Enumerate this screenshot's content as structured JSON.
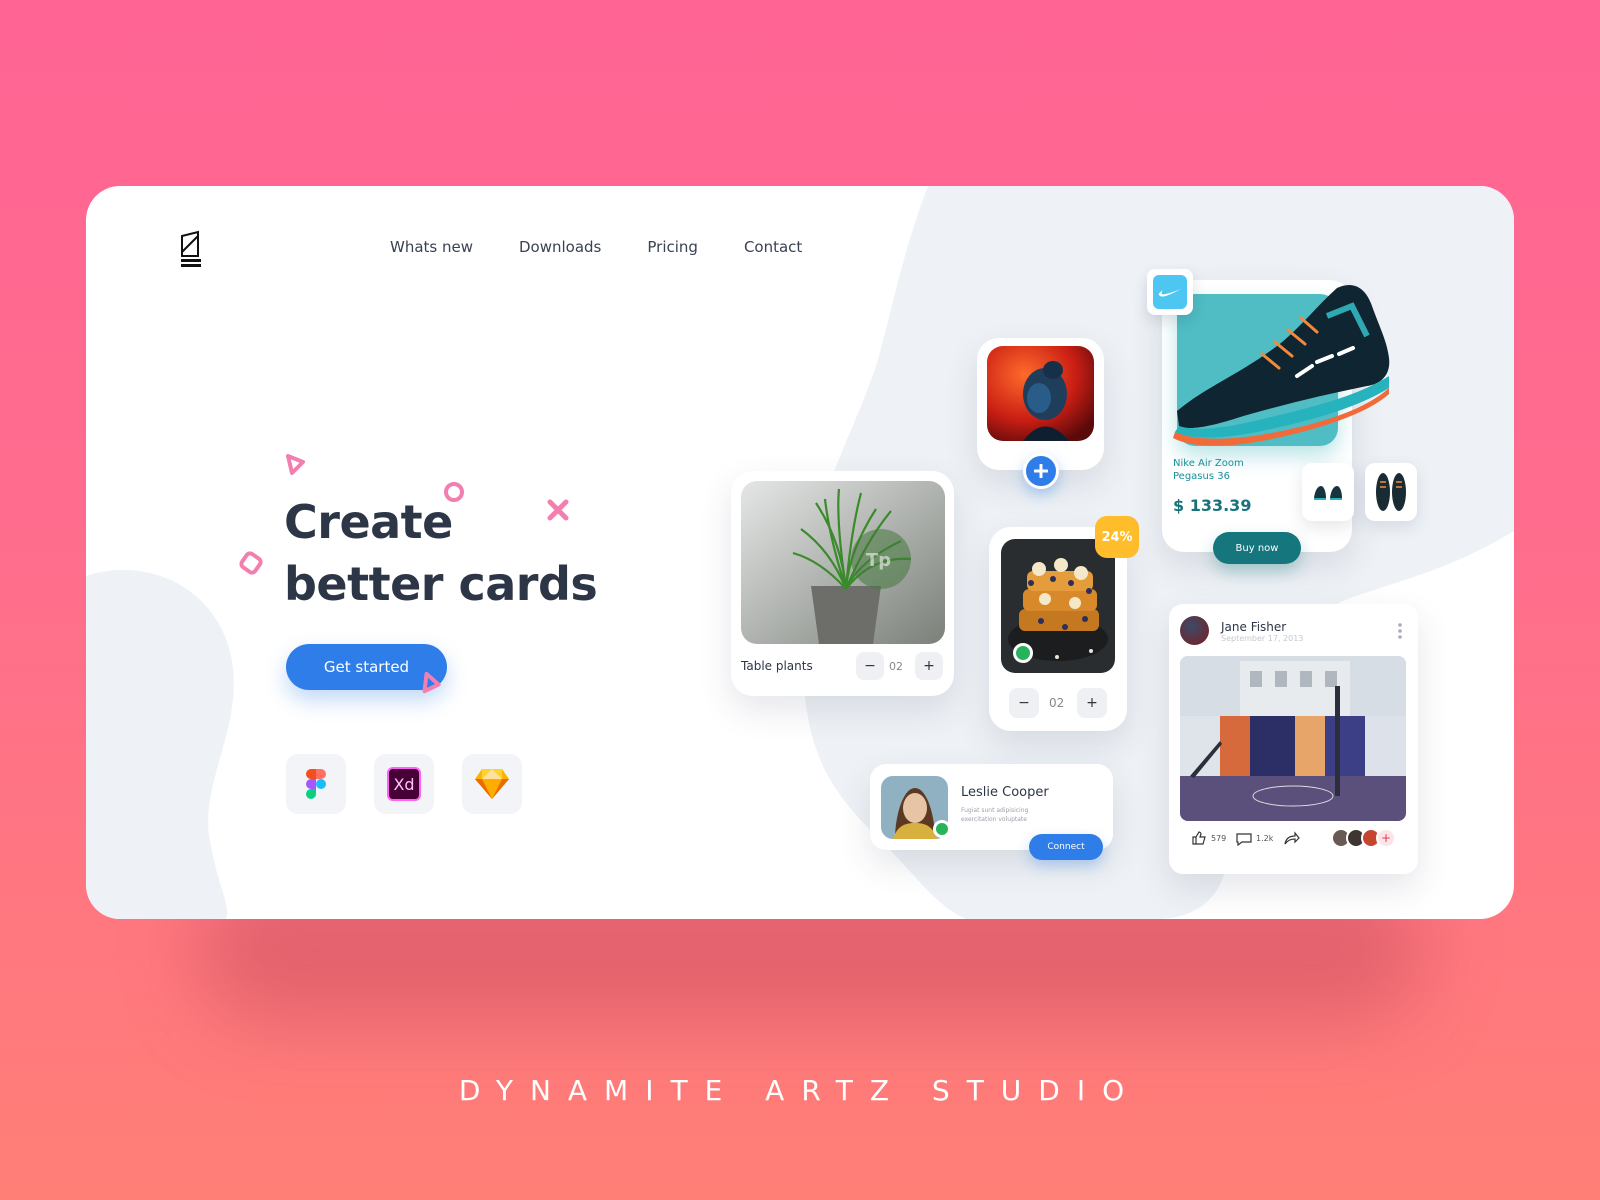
{
  "nav": {
    "items": [
      "Whats new",
      "Downloads",
      "Pricing",
      "Contact"
    ]
  },
  "hero": {
    "title_line1": "Create",
    "title_line2": "better cards",
    "cta_label": "Get started"
  },
  "tools": [
    {
      "name": "Figma",
      "icon": "figma-icon"
    },
    {
      "name": "Adobe XD",
      "label": "Xd",
      "icon": "xd-icon"
    },
    {
      "name": "Sketch",
      "icon": "sketch-icon"
    }
  ],
  "plant_card": {
    "label": "Table plants",
    "watermark": "Tp",
    "quantity": "02",
    "minus": "−",
    "plus": "+"
  },
  "food_card": {
    "badge": "24%",
    "quantity": "02",
    "minus": "−",
    "plus": "+"
  },
  "shoe_card": {
    "name": "Nike Air Zoom Pegasus 36",
    "price": "$ 133.39",
    "cta_label": "Buy now",
    "colors": {
      "accent": "#15767d",
      "tile": "#4fbdc3"
    }
  },
  "social_card": {
    "name": "Jane Fisher",
    "date": "September 17, 2013",
    "likes": "579",
    "comments": "1.2k",
    "add": "+"
  },
  "contact_card": {
    "name": "Leslie Cooper",
    "description": "Fugiat sunt adipisicing exercitation voluptate",
    "cta_label": "Connect"
  },
  "footer": {
    "studio": "DYNAMITE ARTZ STUDIO"
  },
  "colors": {
    "primary": "#2f7de9",
    "badge": "#ffbc2b",
    "online": "#27b35a",
    "deco_pink": "#f27fb0"
  }
}
